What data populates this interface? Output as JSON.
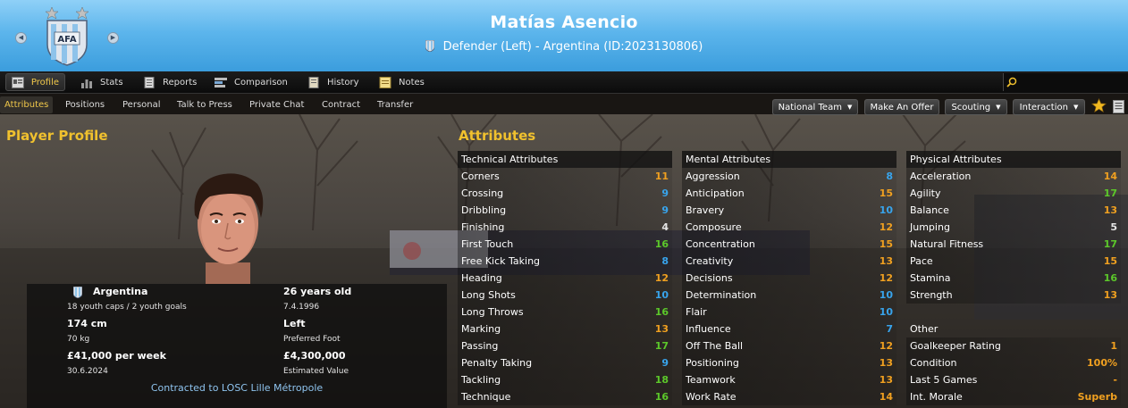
{
  "header": {
    "name": "Matías Asencio",
    "subtitle": "Defender (Left) - Argentina (ID:2023130806)",
    "crest_icon": "afa-crest-icon",
    "prev_icon": "prev-arrow-icon",
    "next_icon": "next-arrow-icon"
  },
  "tabs": [
    {
      "label": "Profile",
      "icon": "profile-icon",
      "active": true
    },
    {
      "label": "Stats",
      "icon": "stats-icon"
    },
    {
      "label": "Reports",
      "icon": "reports-icon"
    },
    {
      "label": "Comparison",
      "icon": "comparison-icon"
    },
    {
      "label": "History",
      "icon": "history-icon"
    },
    {
      "label": "Notes",
      "icon": "notes-icon"
    }
  ],
  "subtabs": [
    {
      "label": "Attributes",
      "active": true
    },
    {
      "label": "Positions"
    },
    {
      "label": "Personal"
    },
    {
      "label": "Talk to Press"
    },
    {
      "label": "Private Chat"
    },
    {
      "label": "Contract"
    },
    {
      "label": "Transfer"
    }
  ],
  "actions": {
    "national_team": "National Team",
    "make_offer": "Make An Offer",
    "scouting": "Scouting",
    "interaction": "Interaction"
  },
  "profile": {
    "title": "Player Profile",
    "nation": "Argentina",
    "caps": "18 youth caps / 2 youth goals",
    "age": "26 years old",
    "dob": "7.4.1996",
    "height": "174 cm",
    "weight": "70 kg",
    "foot": "Left",
    "foot_label": "Preferred Foot",
    "wage": "£41,000 per week",
    "contract_end": "30.6.2024",
    "value": "£4,300,000",
    "value_label": "Estimated Value",
    "contract": "Contracted to LOSC Lille Métropole"
  },
  "attributes": {
    "title": "Attributes",
    "colors": {
      "low": "#e6e6e6",
      "blue": "#38a4ec",
      "orange": "#f0a020",
      "green": "#5cc82a"
    },
    "technical": {
      "heading": "Technical Attributes",
      "rows": [
        {
          "name": "Corners",
          "value": "11"
        },
        {
          "name": "Crossing",
          "value": "9"
        },
        {
          "name": "Dribbling",
          "value": "9"
        },
        {
          "name": "Finishing",
          "value": "4"
        },
        {
          "name": "First Touch",
          "value": "16"
        },
        {
          "name": "Free Kick Taking",
          "value": "8"
        },
        {
          "name": "Heading",
          "value": "12"
        },
        {
          "name": "Long Shots",
          "value": "10"
        },
        {
          "name": "Long Throws",
          "value": "16"
        },
        {
          "name": "Marking",
          "value": "13"
        },
        {
          "name": "Passing",
          "value": "17"
        },
        {
          "name": "Penalty Taking",
          "value": "9"
        },
        {
          "name": "Tackling",
          "value": "18"
        },
        {
          "name": "Technique",
          "value": "16"
        }
      ]
    },
    "mental": {
      "heading": "Mental Attributes",
      "rows": [
        {
          "name": "Aggression",
          "value": "8"
        },
        {
          "name": "Anticipation",
          "value": "15"
        },
        {
          "name": "Bravery",
          "value": "10"
        },
        {
          "name": "Composure",
          "value": "12"
        },
        {
          "name": "Concentration",
          "value": "15"
        },
        {
          "name": "Creativity",
          "value": "13"
        },
        {
          "name": "Decisions",
          "value": "12"
        },
        {
          "name": "Determination",
          "value": "10"
        },
        {
          "name": "Flair",
          "value": "10"
        },
        {
          "name": "Influence",
          "value": "7"
        },
        {
          "name": "Off The Ball",
          "value": "12"
        },
        {
          "name": "Positioning",
          "value": "13"
        },
        {
          "name": "Teamwork",
          "value": "13"
        },
        {
          "name": "Work Rate",
          "value": "14"
        }
      ]
    },
    "physical": {
      "heading": "Physical Attributes",
      "rows": [
        {
          "name": "Acceleration",
          "value": "14"
        },
        {
          "name": "Agility",
          "value": "17"
        },
        {
          "name": "Balance",
          "value": "13"
        },
        {
          "name": "Jumping",
          "value": "5"
        },
        {
          "name": "Natural Fitness",
          "value": "17"
        },
        {
          "name": "Pace",
          "value": "15"
        },
        {
          "name": "Stamina",
          "value": "16"
        },
        {
          "name": "Strength",
          "value": "13"
        }
      ]
    },
    "other": {
      "heading": "Other",
      "rows": [
        {
          "name": "Goalkeeper Rating",
          "value": "1",
          "color": "orange"
        },
        {
          "name": "Condition",
          "value": "100%",
          "color": "orange"
        },
        {
          "name": "Last 5 Games",
          "value": "-",
          "color": "orange"
        },
        {
          "name": "Int. Morale",
          "value": "Superb",
          "color": "orange"
        }
      ]
    }
  }
}
